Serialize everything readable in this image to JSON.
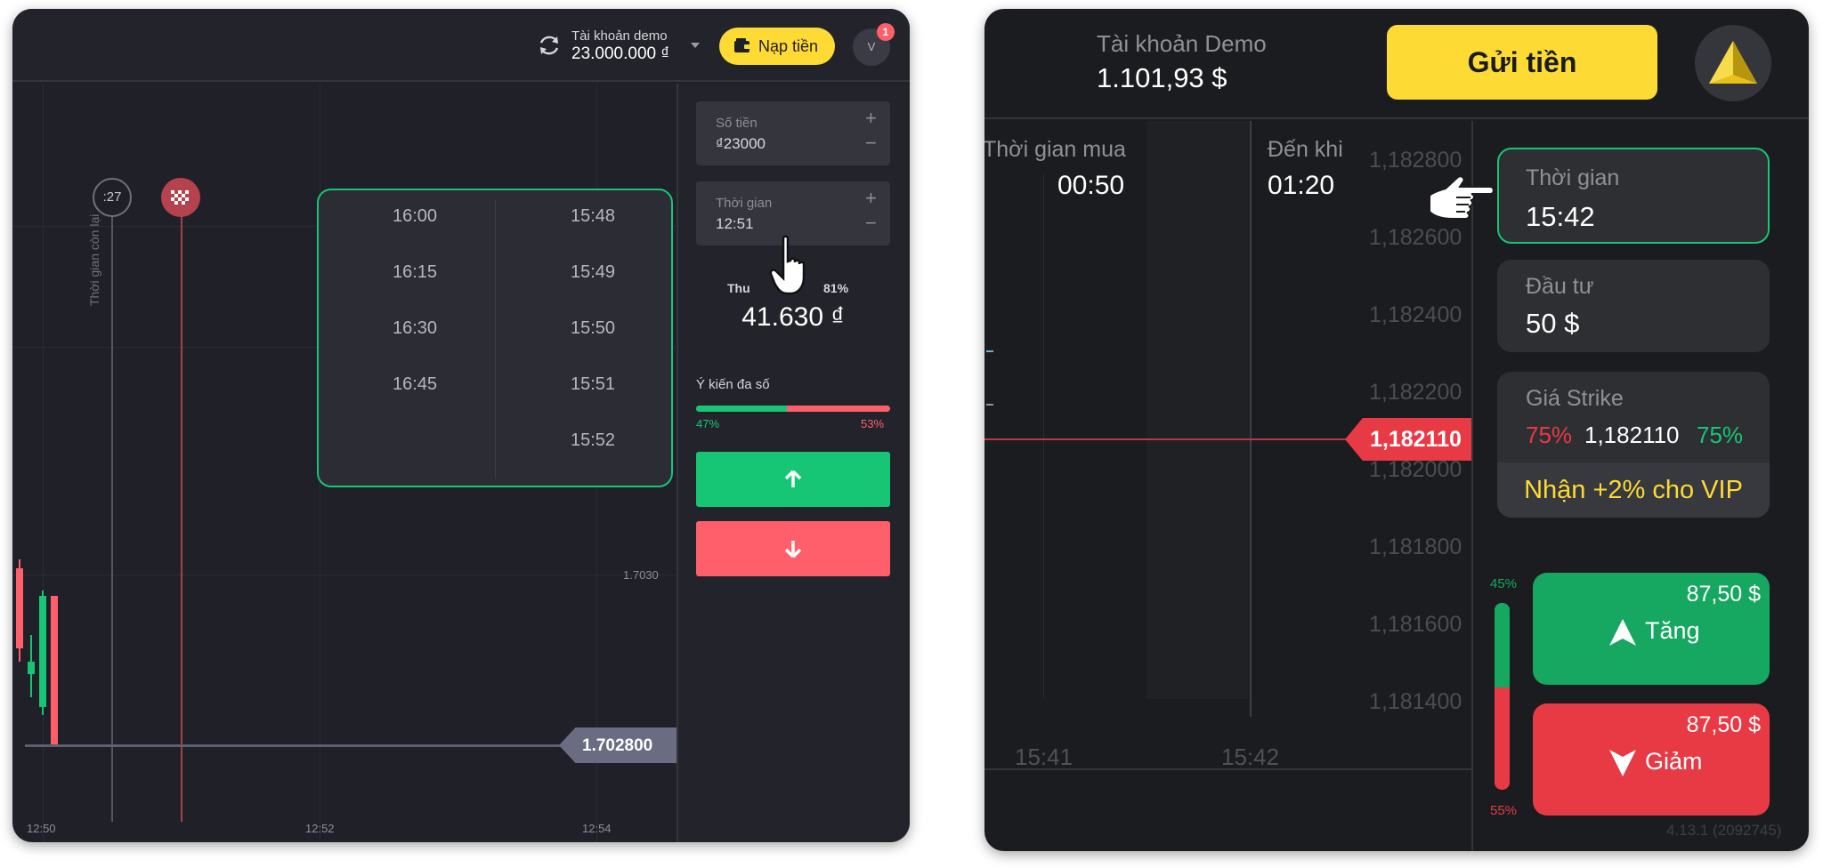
{
  "left": {
    "header": {
      "account_label": "Tài khoản demo",
      "balance": "23.000.000 ₫",
      "deposit_label": "Nạp tiền",
      "avatar_letter": "V",
      "notification_count": "1"
    },
    "chart": {
      "timer": ":27",
      "time_remaining_label": "Thời gian còn lại",
      "price_label": "1.7030",
      "current_price": "1.702800",
      "x_ticks": [
        "12:50",
        "12:52",
        "12:54"
      ]
    },
    "dropdown": {
      "col1": [
        "16:00",
        "16:15",
        "16:30",
        "16:45"
      ],
      "col2": [
        "15:48",
        "15:49",
        "15:50",
        "15:51",
        "15:52"
      ]
    },
    "sidebar": {
      "amount_label": "Số tiền",
      "amount_value": "₫23000",
      "time_label": "Thời gian",
      "time_value": "12:51",
      "payout_label": "Thu",
      "payout_percent": "81%",
      "payout_value": "41.630 ₫",
      "sentiment_label": "Ý kiến đa số",
      "sentiment_up": "47%",
      "sentiment_down": "53%",
      "sentiment_up_fraction": 0.47
    }
  },
  "right": {
    "header": {
      "account_label": "Tài khoản Demo",
      "balance": "1.101,93 $",
      "deposit_label": "Gửi tiền"
    },
    "chart": {
      "buy_time_label": "Thời gian mua",
      "buy_time_value": "00:50",
      "until_label": "Đến khi",
      "until_value": "01:20",
      "y_ticks": [
        "1,182800",
        "1,182600",
        "1,182400",
        "1,182200",
        "1,182000",
        "1,181800",
        "1,181600",
        "1,181400"
      ],
      "current_price": "1,182110",
      "x_ticks": [
        "15:41",
        "15:42"
      ]
    },
    "sidebar": {
      "time_label": "Thời gian",
      "time_value": "15:42",
      "invest_label": "Đầu tư",
      "invest_value": "50 $",
      "strike_label": "Giá Strike",
      "strike_down_pct": "75%",
      "strike_price": "1,182110",
      "strike_up_pct": "75%",
      "vip_text": "Nhận +2% cho VIP",
      "sentiment_up": "45%",
      "sentiment_down": "55%",
      "sentiment_up_fraction": 0.45,
      "up_payout": "87,50 $",
      "up_label": "Tăng",
      "down_payout": "87,50 $",
      "down_label": "Giảm"
    },
    "version": "4.13.1 (2092745)"
  },
  "colors": {
    "green": "#16c674",
    "red": "#ff5f6b",
    "yellow": "#fddb34",
    "right_green": "#16a861",
    "right_red": "#e83a45"
  }
}
